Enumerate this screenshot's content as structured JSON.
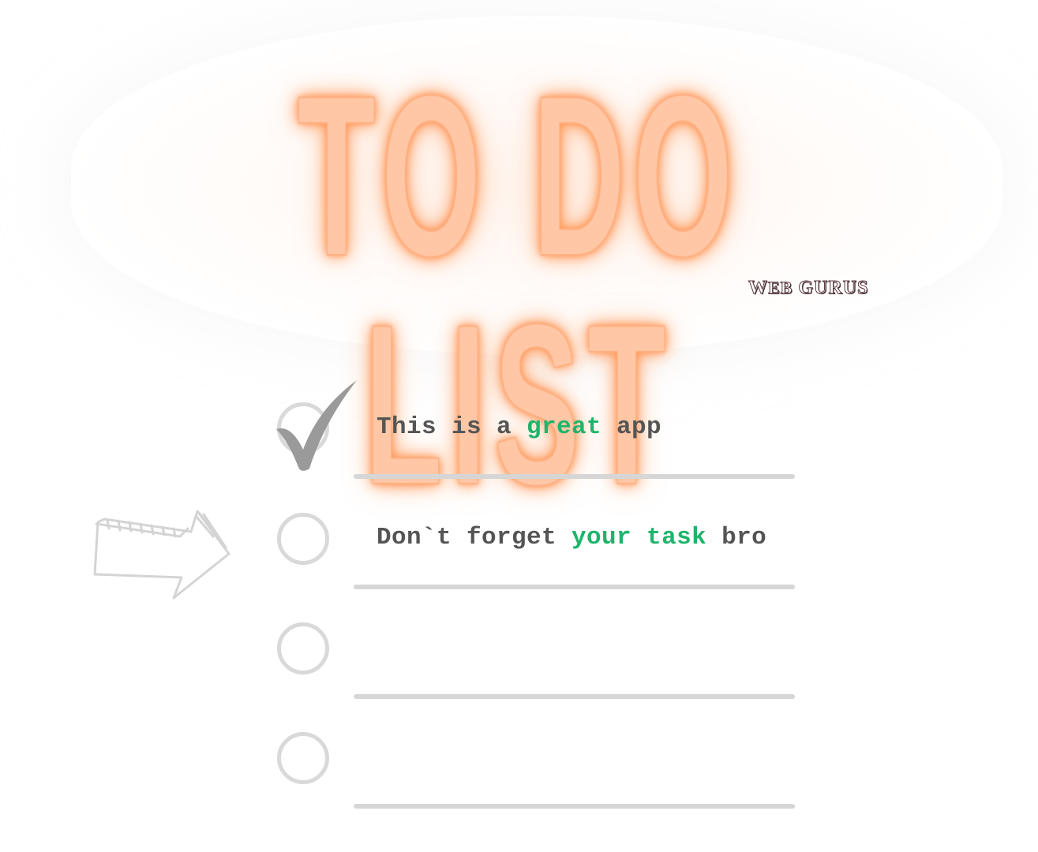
{
  "header": {
    "title": "TO DO LIST",
    "brand_big_1": "W",
    "brand_small_1": "EB",
    "brand_big_2": "GURUS"
  },
  "icons": {
    "check": "check-icon",
    "arrow": "arrow-right-icon",
    "checkbox": "circle-checkbox-icon"
  },
  "colors": {
    "title_fill": "#ffc7a5",
    "title_glow": "#ff8c47",
    "highlight": "#1db56b",
    "text": "#555555",
    "line": "#d6d6d6",
    "checkbox": "#d9d9d9"
  },
  "tasks": [
    {
      "checked": true,
      "parts": [
        {
          "text": "This is a ",
          "hl": false
        },
        {
          "text": "great",
          "hl": true
        },
        {
          "text": " app",
          "hl": false
        }
      ]
    },
    {
      "checked": false,
      "parts": [
        {
          "text": "Don`t forget ",
          "hl": false
        },
        {
          "text": "your task",
          "hl": true
        },
        {
          "text": " bro",
          "hl": false
        }
      ]
    },
    {
      "checked": false,
      "parts": []
    },
    {
      "checked": false,
      "parts": []
    }
  ]
}
